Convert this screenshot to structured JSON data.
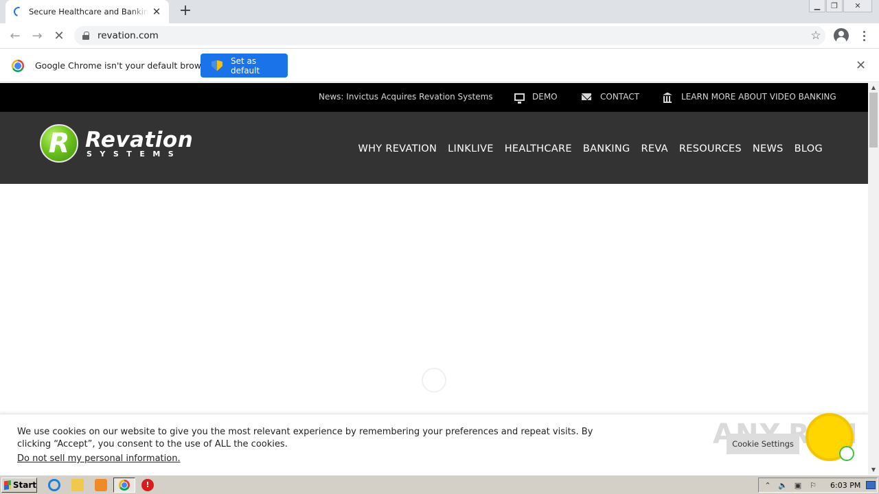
{
  "browser": {
    "tab_title": "Secure Healthcare and Banking Communications",
    "new_tab_symbol": "+",
    "tab_close_symbol": "✕",
    "url": "revation.com",
    "infobar_text": "Google Chrome isn't your default browser",
    "set_default_label": "Set as default",
    "infobar_close_symbol": "✕"
  },
  "site": {
    "topbar": {
      "news": "News: Invictus Acquires Revation Systems",
      "demo": "DEMO",
      "contact": "CONTACT",
      "video_banking": "LEARN MORE ABOUT VIDEO BANKING"
    },
    "logo": {
      "mark": "R",
      "word": "Revation",
      "sub": "SYSTEMS"
    },
    "menu": [
      "WHY REVATION",
      "LINKLIVE",
      "HEALTHCARE",
      "BANKING",
      "REVA",
      "RESOURCES",
      "NEWS",
      "BLOG"
    ]
  },
  "cookie": {
    "text": "We use cookies on our website to give you the most relevant experience by remembering your preferences and repeat visits. By clicking “Accept”, you consent to the use of ALL the cookies.",
    "do_not_sell": "Do not sell my personal information",
    "period": ".",
    "settings_label": "Cookie Settings"
  },
  "watermark": "ANY.RUN",
  "taskbar": {
    "start_label": "Start",
    "clock": "6:03 PM"
  },
  "colors": {
    "accent_blue": "#1a73e8",
    "topbar_bg": "#000000",
    "nav_bg": "#333333",
    "logo_green": "#6fc420",
    "chat_yellow": "#ffd600"
  }
}
